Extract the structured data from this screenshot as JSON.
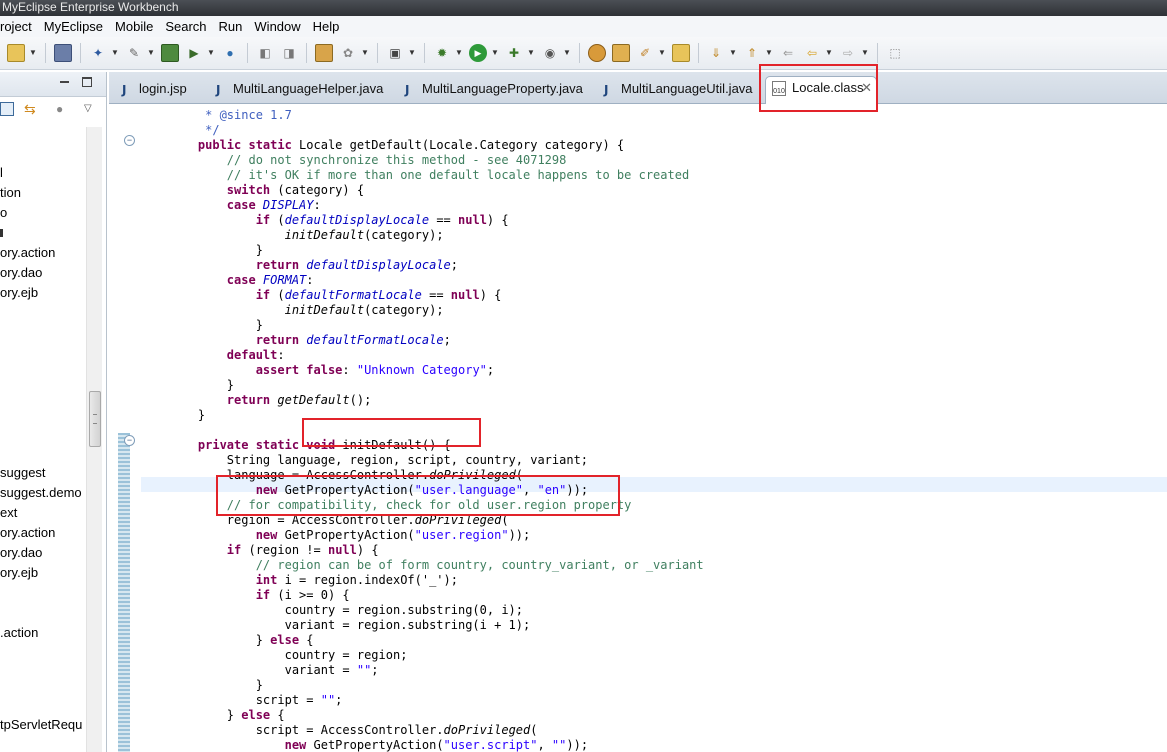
{
  "window": {
    "title": "MyEclipse Enterprise Workbench"
  },
  "menu": [
    "roject",
    "MyEclipse",
    "Mobile",
    "Search",
    "Run",
    "Window",
    "Help"
  ],
  "tabs": [
    {
      "label": "login.jsp",
      "icon": "jsp-file-icon",
      "active": false
    },
    {
      "label": "MultiLanguageHelper.java",
      "icon": "java-file-icon",
      "active": false
    },
    {
      "label": "MultiLanguageProperty.java",
      "icon": "java-file-icon",
      "active": false
    },
    {
      "label": "MultiLanguageUtil.java",
      "icon": "java-file-icon",
      "active": false
    },
    {
      "label": "Locale.class",
      "icon": "class-file-icon",
      "active": true,
      "close": "✕"
    }
  ],
  "class_icon_text": "010",
  "tree": [
    "l",
    "tion",
    "o",
    "",
    "ory.action",
    "ory.dao",
    "ory.ejb",
    "suggest",
    "suggest.demo",
    "ext",
    "ory.action",
    "ory.dao",
    "ory.ejb",
    ".action",
    "tpServletRequ"
  ],
  "code": [
    [
      [
        "jd",
        "     * @since 1.7"
      ]
    ],
    [
      [
        "jd",
        "     */"
      ]
    ],
    [
      [
        "kw",
        "    public static "
      ],
      [
        "",
        "Locale getDefault(Locale.Category category) {"
      ]
    ],
    [
      [
        "cm",
        "        // do not synchronize this method - see 4071298"
      ]
    ],
    [
      [
        "cm",
        "        // it's OK if more than one default locale happens to be created"
      ]
    ],
    [
      [
        "kw",
        "        switch "
      ],
      [
        "",
        "(category) {"
      ]
    ],
    [
      [
        "kw",
        "        case "
      ],
      [
        "fi",
        "DISPLAY"
      ],
      [
        "",
        ":"
      ]
    ],
    [
      [
        "kw",
        "            if "
      ],
      [
        "",
        "("
      ],
      [
        "fi",
        "defaultDisplayLocale"
      ],
      [
        "",
        " == "
      ],
      [
        "kw",
        "null"
      ],
      [
        "",
        ") {"
      ]
    ],
    [
      [
        "it",
        "                initDefault"
      ],
      [
        "",
        "(category);"
      ]
    ],
    [
      [
        "",
        "            }"
      ]
    ],
    [
      [
        "kw",
        "            return "
      ],
      [
        "fi",
        "defaultDisplayLocale"
      ],
      [
        "",
        ";"
      ]
    ],
    [
      [
        "kw",
        "        case "
      ],
      [
        "fi",
        "FORMAT"
      ],
      [
        "",
        ":"
      ]
    ],
    [
      [
        "kw",
        "            if "
      ],
      [
        "",
        "("
      ],
      [
        "fi",
        "defaultFormatLocale"
      ],
      [
        "",
        " == "
      ],
      [
        "kw",
        "null"
      ],
      [
        "",
        ") {"
      ]
    ],
    [
      [
        "it",
        "                initDefault"
      ],
      [
        "",
        "(category);"
      ]
    ],
    [
      [
        "",
        "            }"
      ]
    ],
    [
      [
        "kw",
        "            return "
      ],
      [
        "fi",
        "defaultFormatLocale"
      ],
      [
        "",
        ";"
      ]
    ],
    [
      [
        "kw",
        "        default"
      ],
      [
        "",
        ":"
      ]
    ],
    [
      [
        "kw",
        "            assert false"
      ],
      [
        "",
        ": "
      ],
      [
        "st",
        "\"Unknown Category\""
      ],
      [
        "",
        ";"
      ]
    ],
    [
      [
        "",
        "        }"
      ]
    ],
    [
      [
        "kw",
        "        return "
      ],
      [
        "it",
        "getDefault"
      ],
      [
        "",
        "();"
      ]
    ],
    [
      [
        "",
        "    }"
      ]
    ],
    [
      [
        "",
        ""
      ]
    ],
    [
      [
        "kw",
        "    private static void "
      ],
      [
        "",
        "initDefault() {"
      ]
    ],
    [
      [
        "",
        "        String language, region, script, country, variant;"
      ]
    ],
    [
      [
        "",
        "        language = AccessController."
      ],
      [
        "it",
        "doPrivileged"
      ],
      [
        "",
        "("
      ]
    ],
    [
      [
        "kw",
        "            new "
      ],
      [
        "",
        "GetPropertyAction("
      ],
      [
        "st",
        "\"user.language\""
      ],
      [
        "",
        ", "
      ],
      [
        "st",
        "\"en\""
      ],
      [
        "",
        "));"
      ]
    ],
    [
      [
        "cm",
        "        // for compatibility, check for old user.region property"
      ]
    ],
    [
      [
        "",
        "        region = AccessController."
      ],
      [
        "it",
        "doPrivileged"
      ],
      [
        "",
        "("
      ]
    ],
    [
      [
        "kw",
        "            new "
      ],
      [
        "",
        "GetPropertyAction("
      ],
      [
        "st",
        "\"user.region\""
      ],
      [
        "",
        "));"
      ]
    ],
    [
      [
        "kw",
        "        if "
      ],
      [
        "",
        "(region != "
      ],
      [
        "kw",
        "null"
      ],
      [
        "",
        ") {"
      ]
    ],
    [
      [
        "cm",
        "            // region can be of form country, country_variant, or _variant"
      ]
    ],
    [
      [
        "kw",
        "            int "
      ],
      [
        "",
        "i = region.indexOf('_');"
      ]
    ],
    [
      [
        "kw",
        "            if "
      ],
      [
        "",
        "(i >= 0) {"
      ]
    ],
    [
      [
        "",
        "                country = region.substring(0, i);"
      ]
    ],
    [
      [
        "",
        "                variant = region.substring(i + 1);"
      ]
    ],
    [
      [
        "",
        "            } "
      ],
      [
        "kw",
        "else "
      ],
      [
        "",
        "{"
      ]
    ],
    [
      [
        "",
        "                country = region;"
      ]
    ],
    [
      [
        "",
        "                variant = "
      ],
      [
        "st",
        "\"\""
      ],
      [
        "",
        ";"
      ]
    ],
    [
      [
        "",
        "            }"
      ]
    ],
    [
      [
        "",
        "            script = "
      ],
      [
        "st",
        "\"\""
      ],
      [
        "",
        ";"
      ]
    ],
    [
      [
        "",
        "        } "
      ],
      [
        "kw",
        "else "
      ],
      [
        "",
        "{"
      ]
    ],
    [
      [
        "",
        "            script = AccessController."
      ],
      [
        "it",
        "doPrivileged"
      ],
      [
        "",
        "("
      ]
    ],
    [
      [
        "kw",
        "                new "
      ],
      [
        "",
        "GetPropertyAction("
      ],
      [
        "st",
        "\"user.script\""
      ],
      [
        "",
        ", "
      ],
      [
        "st",
        "\"\""
      ],
      [
        "",
        "));"
      ]
    ]
  ],
  "colors": {
    "keyword": "#7f0055",
    "comment": "#3f7f5f",
    "javadoc": "#3f5fbf",
    "string": "#2a00ff",
    "field": "#0000c0",
    "annotation_box": "#e2232a"
  }
}
